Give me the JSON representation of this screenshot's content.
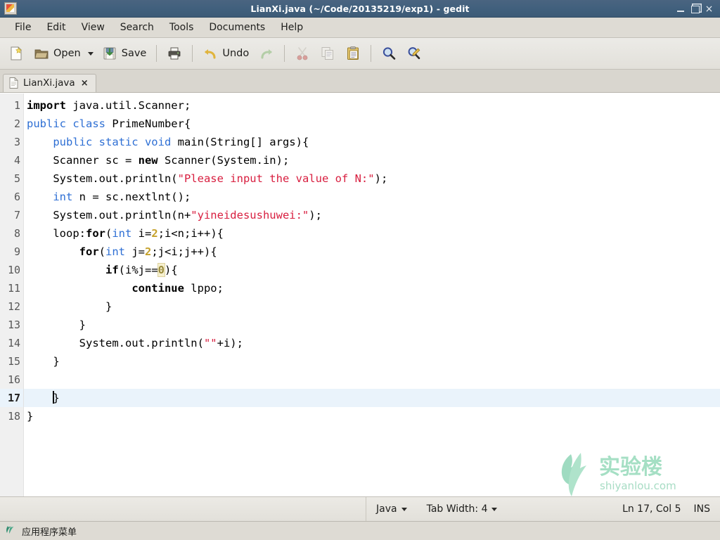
{
  "window": {
    "title": "LianXi.java (~/Code/20135219/exp1) - gedit",
    "app_icon": "gedit-icon",
    "minimize_label": "",
    "maximize_label": "",
    "close_label": "×"
  },
  "menubar": {
    "items": [
      {
        "label": "File"
      },
      {
        "label": "Edit"
      },
      {
        "label": "View"
      },
      {
        "label": "Search"
      },
      {
        "label": "Tools"
      },
      {
        "label": "Documents"
      },
      {
        "label": "Help"
      }
    ]
  },
  "toolbar": {
    "new_label": "",
    "open_label": "Open",
    "save_label": "Save",
    "print_label": "",
    "undo_label": "Undo",
    "redo_label": "",
    "cut_label": "",
    "copy_label": "",
    "paste_label": "",
    "find_label": "",
    "replace_label": ""
  },
  "tabs": [
    {
      "label": "LianXi.java",
      "close": "×",
      "active": true
    }
  ],
  "editor": {
    "lines": [
      {
        "n": "1",
        "current": false
      },
      {
        "n": "2",
        "current": false
      },
      {
        "n": "3",
        "current": false
      },
      {
        "n": "4",
        "current": false
      },
      {
        "n": "5",
        "current": false
      },
      {
        "n": "6",
        "current": false
      },
      {
        "n": "7",
        "current": false
      },
      {
        "n": "8",
        "current": false
      },
      {
        "n": "9",
        "current": false
      },
      {
        "n": "10",
        "current": false
      },
      {
        "n": "11",
        "current": false
      },
      {
        "n": "12",
        "current": false
      },
      {
        "n": "13",
        "current": false
      },
      {
        "n": "14",
        "current": false
      },
      {
        "n": "15",
        "current": false
      },
      {
        "n": "16",
        "current": false
      },
      {
        "n": "17",
        "current": true
      },
      {
        "n": "18",
        "current": false
      }
    ],
    "source": [
      "import java.util.Scanner;",
      "public class PrimeNumber{",
      "    public static void main(String[] args){",
      "    Scanner sc = new Scanner(System.in);",
      "    System.out.println(\"Please input the value of N:\");",
      "    int n = sc.nextlnt();",
      "    System.out.println(n+\"yineidesushuwei:\");",
      "    loop:for(int i=2;i<n;i++){",
      "        for(int j=2;j<i;j++){",
      "            if(i%j==0){",
      "                continue lppo;",
      "            }",
      "        }",
      "        System.out.println(\"\"+i);",
      "    }",
      "",
      "    }",
      "}"
    ],
    "language": "Java",
    "cursor_line": 17,
    "cursor_col": 5
  },
  "statusbar": {
    "language": "Java",
    "tab_width": "Tab Width: 4",
    "position": "Ln 17, Col 5",
    "insert_mode": "INS"
  },
  "watermark": {
    "text_cn": "实验楼",
    "text_url": "shiyanlou.com",
    "color": "#5fc49a"
  },
  "taskbar": {
    "menu_label": "应用程序菜单",
    "icon": "application-menu-icon"
  },
  "colors": {
    "titlebar": "#41607d",
    "chrome": "#dedbd4",
    "keyword": "#2e6fd4",
    "string": "#d81e3f",
    "number": "#c5a12b",
    "current_line": "#eaf3fb",
    "gutter": "#f0f0f0"
  }
}
